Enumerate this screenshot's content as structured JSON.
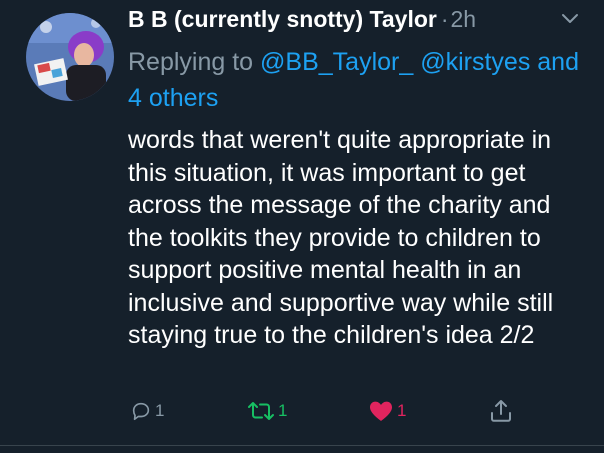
{
  "tweet": {
    "display_name": "B B (currently snotty) Taylor",
    "separator": "·",
    "time": "2h",
    "reply_prefix": "Replying to",
    "mention_1": "@BB_Taylor_",
    "mention_2": "@kirstyes",
    "others": "and 4 others",
    "text": "words that weren't quite appropriate in this situation, it was important to get across the message of the charity and the toolkits they provide to children to support positive mental health in an inclusive and supportive way while still staying true to the children's idea 2/2"
  },
  "actions": {
    "reply_count": "1",
    "retweet_count": "1",
    "like_count": "1"
  },
  "colors": {
    "background": "#15202b",
    "secondary_text": "#8899a6",
    "link": "#1da1f2",
    "retweet_active": "#17bf63",
    "like_active": "#e0245e"
  },
  "icons": [
    "avatar",
    "chevron-down-icon",
    "reply-icon",
    "retweet-icon",
    "heart-icon",
    "share-icon"
  ]
}
